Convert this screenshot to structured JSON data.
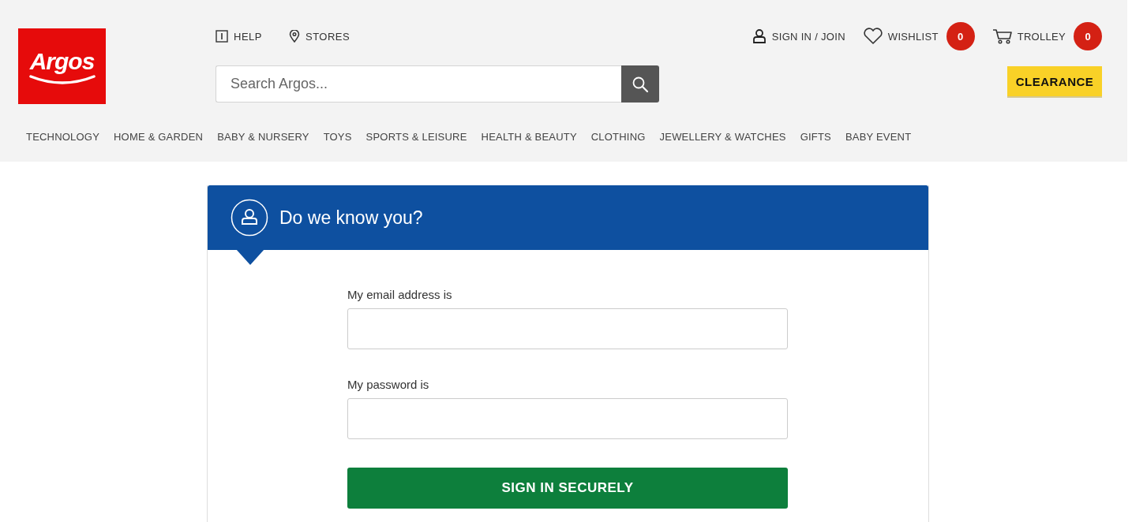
{
  "logo": "Argos",
  "utility_links": [
    {
      "label": "HELP",
      "kind": "help"
    },
    {
      "label": "STORES",
      "kind": "stores"
    }
  ],
  "search": {
    "placeholder": "Search Argos..."
  },
  "account_links": [
    {
      "label": "SIGN IN / JOIN",
      "kind": "account"
    },
    {
      "label": "WISHLIST",
      "kind": "wishlist",
      "count": "0"
    },
    {
      "label": "TROLLEY",
      "kind": "trolley",
      "count": "0"
    }
  ],
  "clearance_button": "CLEARANCE",
  "nav": [
    "TECHNOLOGY",
    "HOME & GARDEN",
    "BABY & NURSERY",
    "TOYS",
    "SPORTS & LEISURE",
    "HEALTH & BEAUTY",
    "CLOTHING",
    "JEWELLERY & WATCHES",
    "GIFTS",
    "BABY EVENT"
  ],
  "signin": {
    "title": "Do we know you?",
    "email_label": "My email address is",
    "password_label": "My password is",
    "submit": "SIGN IN SECURELY"
  }
}
